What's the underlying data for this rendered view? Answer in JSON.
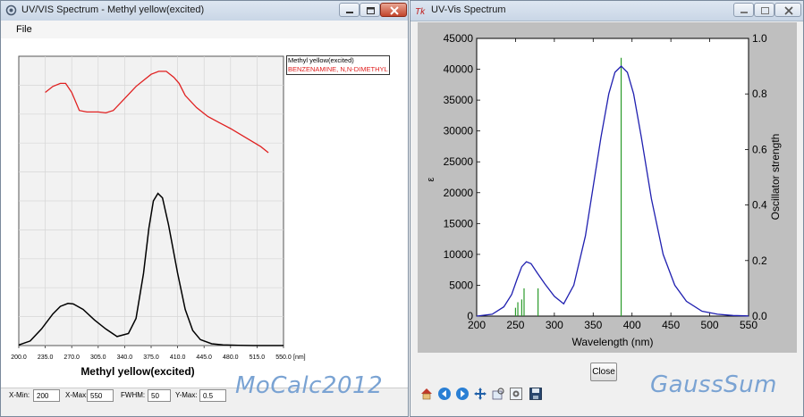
{
  "left_window": {
    "title": "UV/VIS Spectrum - Methyl yellow(excited)",
    "menu": [
      "File"
    ],
    "plot_title": "Methyl yellow(excited)",
    "x_unit": "[nm]",
    "legend": [
      "Methyl yellow(excited)",
      "BENZENAMINE, N,N-DIMETHYL"
    ],
    "controls": {
      "xmin_label": "X-Min:",
      "xmin_value": "200",
      "xmax_label": "X-Max:",
      "xmax_value": "550",
      "fwhm_label": "FWHM:",
      "fwhm_value": "50",
      "ymax_label": "Y-Max:",
      "ymax_value": "0.5"
    },
    "watermark": "MoCalc2012"
  },
  "right_window": {
    "title": "UV-Vis Spectrum",
    "close_label": "Close",
    "toolbar": [
      "home-icon",
      "back-arrow-icon",
      "forward-arrow-icon",
      "pan-icon",
      "zoom-icon",
      "configure-subplots-icon",
      "save-icon"
    ],
    "watermark": "GaussSum"
  },
  "colors": {
    "experimental_curve": "#e02020",
    "calculated_curve": "#000000",
    "matplotlib_curve": "#2020b0",
    "oscillator_lines": "#2a9a2a",
    "watermark": "#7aa3d3"
  },
  "chart_data": [
    {
      "type": "line",
      "xlim": [
        200.0,
        550.0
      ],
      "x_ticks": [
        "200.0",
        "235.0",
        "270.0",
        "305.0",
        "340.0",
        "375.0",
        "410.0",
        "445.0",
        "480.0",
        "515.0",
        "550.0"
      ],
      "grid": true,
      "legend_position": "top-right",
      "series": [
        {
          "name": "Methyl yellow(excited)",
          "x": [
            200,
            215,
            230,
            245,
            255,
            265,
            272,
            285,
            300,
            315,
            330,
            345,
            355,
            365,
            372,
            378,
            384,
            390,
            398,
            410,
            420,
            430,
            440,
            455,
            470,
            490,
            510,
            530,
            550
          ],
          "y": [
            0.002,
            0.015,
            0.055,
            0.105,
            0.13,
            0.14,
            0.138,
            0.12,
            0.085,
            0.055,
            0.03,
            0.04,
            0.09,
            0.24,
            0.39,
            0.48,
            0.505,
            0.49,
            0.4,
            0.24,
            0.12,
            0.05,
            0.02,
            0.006,
            0.002,
            0.001,
            0.0,
            0.0,
            0.0
          ]
        },
        {
          "name": "BENZENAMINE, N,N-DIMETHYL",
          "x": [
            235,
            245,
            255,
            262,
            270,
            280,
            290,
            305,
            315,
            325,
            340,
            355,
            365,
            375,
            385,
            395,
            405,
            412,
            420,
            435,
            450,
            465,
            480,
            500,
            520,
            530
          ],
          "y": [
            0.84,
            0.86,
            0.87,
            0.87,
            0.84,
            0.78,
            0.775,
            0.775,
            0.772,
            0.78,
            0.82,
            0.86,
            0.88,
            0.9,
            0.91,
            0.91,
            0.89,
            0.87,
            0.83,
            0.79,
            0.76,
            0.74,
            0.72,
            0.69,
            0.66,
            0.64
          ]
        }
      ]
    },
    {
      "type": "line",
      "xlabel": "Wavelength (nm)",
      "ylabel": "ε",
      "y2label": "Oscillator strength",
      "xlim": [
        200,
        550
      ],
      "ylim": [
        0,
        45000
      ],
      "y2lim": [
        0.0,
        1.0
      ],
      "x_ticks": [
        200,
        250,
        300,
        350,
        400,
        450,
        500,
        550
      ],
      "y_ticks": [
        0,
        5000,
        10000,
        15000,
        20000,
        25000,
        30000,
        35000,
        40000,
        45000
      ],
      "y2_ticks": [
        "0.0",
        "0.2",
        "0.4",
        "0.6",
        "0.8",
        "1.0"
      ],
      "grid": false,
      "series": [
        {
          "x": [
            200,
            220,
            235,
            245,
            252,
            258,
            264,
            270,
            278,
            288,
            300,
            312,
            325,
            340,
            350,
            360,
            370,
            378,
            386,
            394,
            402,
            412,
            425,
            440,
            455,
            470,
            490,
            510,
            530,
            550
          ],
          "y": [
            0,
            300,
            1500,
            3500,
            6000,
            8000,
            8800,
            8500,
            7000,
            5200,
            3200,
            2000,
            5000,
            13000,
            21000,
            29000,
            36000,
            39500,
            40500,
            39500,
            36000,
            29000,
            19000,
            10000,
            5000,
            2400,
            800,
            300,
            100,
            30
          ]
        }
      ],
      "oscillator_lines": {
        "x": [
          250,
          253,
          258,
          261,
          279,
          386
        ],
        "f": [
          0.03,
          0.05,
          0.06,
          0.1,
          0.1,
          0.93
        ]
      }
    }
  ]
}
